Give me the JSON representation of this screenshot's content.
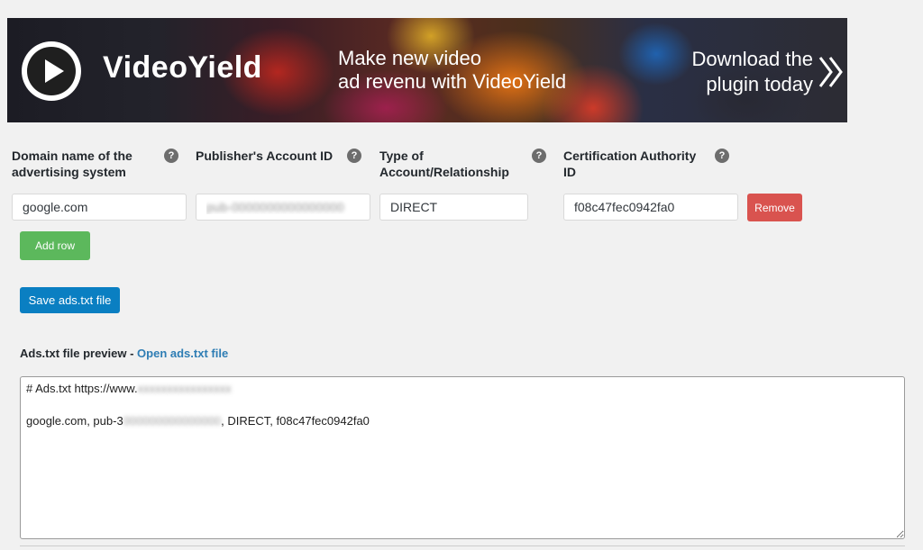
{
  "banner": {
    "brand": "VideoYield",
    "tagline_line1": "Make new video",
    "tagline_line2": "ad revenu with VideoYield",
    "cta_line1": "Download the",
    "cta_line2": "plugin today",
    "icons": {
      "play": "play-icon",
      "chevron": "double-chevron-right-icon"
    }
  },
  "columns": [
    {
      "label": "Domain name of the advertising system"
    },
    {
      "label": "Publisher's Account ID"
    },
    {
      "label": "Type of Account/Relationship"
    },
    {
      "label": "Certification Authority ID"
    }
  ],
  "help_glyph": "?",
  "row": {
    "domain": "google.com",
    "publisher_id": "pub-0000000000000000",
    "relationship": "DIRECT",
    "cert_id": "f08c47fec0942fa0"
  },
  "buttons": {
    "remove": "Remove",
    "add_row": "Add row",
    "save": "Save ads.txt file"
  },
  "preview": {
    "label": "Ads.txt file preview",
    "separator": " - ",
    "link": "Open ads.txt file",
    "line1_prefix": "# Ads.txt https://www.",
    "line1_blurred": "xxxxxxxxxxxxxxxx",
    "line2_prefix": "google.com, pub-3",
    "line2_blurred": "000000000000000",
    "line2_suffix": ", DIRECT, f08c47fec0942fa0"
  },
  "colors": {
    "add_row": "#5cb85c",
    "remove": "#d9534f",
    "save": "#0a7fc2",
    "link": "#2e7db4"
  }
}
